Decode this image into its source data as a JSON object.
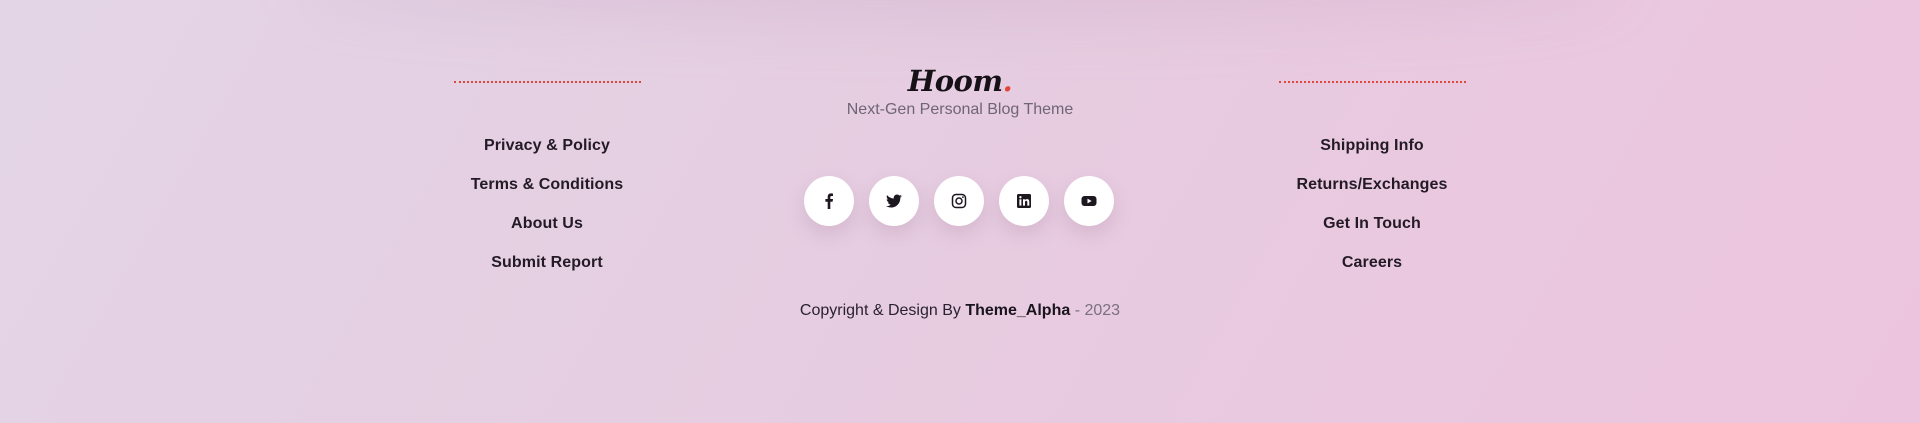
{
  "footer": {
    "left_links": [
      {
        "label": "Privacy & Policy"
      },
      {
        "label": "Terms & Conditions"
      },
      {
        "label": "About Us"
      },
      {
        "label": "Submit Report"
      }
    ],
    "right_links": [
      {
        "label": "Shipping Info"
      },
      {
        "label": "Returns/Exchanges"
      },
      {
        "label": "Get In Touch"
      },
      {
        "label": "Careers"
      }
    ],
    "logo": {
      "text": "Hoom",
      "dot": "."
    },
    "tagline": "Next-Gen Personal Blog Theme",
    "social": [
      {
        "icon": "facebook-icon"
      },
      {
        "icon": "twitter-icon"
      },
      {
        "icon": "instagram-icon"
      },
      {
        "icon": "linkedin-icon"
      },
      {
        "icon": "youtube-icon"
      }
    ],
    "copyright": {
      "prefix": "Copyright & Design By",
      "brand": "Theme_Alpha",
      "separator": "-",
      "year": "2023"
    }
  },
  "colors": {
    "accent": "#e0473a",
    "text": "#231a26",
    "muted": "#6f6575",
    "background_start": "#e3d5e6",
    "background_end": "#edc4de"
  }
}
